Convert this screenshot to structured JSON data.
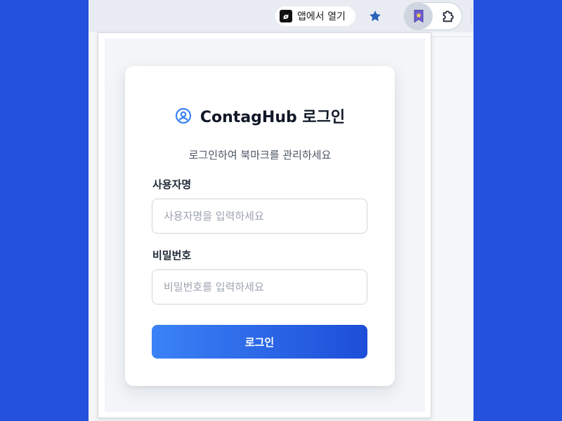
{
  "toolbar": {
    "open_in_app_label": "앱에서 열기",
    "app_icon_glyph": "ø",
    "icons": {
      "star": "star-icon",
      "bookmark_extension": "bookmark-extension-icon",
      "puzzle": "puzzle-extension-icon"
    }
  },
  "login": {
    "title": "ContagHub 로그인",
    "subtitle": "로그인하여 북마크를 관리하세요",
    "username_label": "사용자명",
    "username_placeholder": "사용자명을 입력하세요",
    "username_value": "",
    "password_label": "비밀번호",
    "password_placeholder": "비밀번호를 입력하세요",
    "password_value": "",
    "submit_label": "로그인"
  },
  "colors": {
    "background": "#2451dd",
    "accent_start": "#3b82f6",
    "accent_end": "#1d4ed8",
    "star": "#2a63b8",
    "user_icon": "#3b82f6"
  }
}
